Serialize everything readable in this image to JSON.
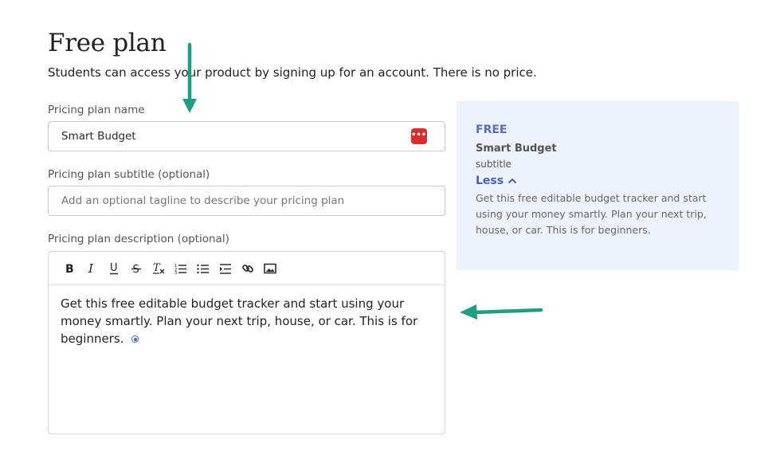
{
  "header": {
    "title": "Free plan",
    "description": "Students can access your product by signing up for an account. There is no price."
  },
  "form": {
    "name_label": "Pricing plan name",
    "name_value": "Smart Budget",
    "password_manager_glyph": "•••|",
    "subtitle_label": "Pricing plan subtitle (optional)",
    "subtitle_placeholder": "Add an optional tagline to describe your pricing plan",
    "description_label": "Pricing plan description (optional)",
    "toolbar": [
      "bold-icon",
      "italic-icon",
      "underline-icon",
      "strikethrough-icon",
      "clear-format-icon",
      "ordered-list-icon",
      "bullet-list-icon",
      "indent-icon",
      "link-icon",
      "image-icon"
    ],
    "description_value": "Get this free editable budget tracker and start using your money smartly. Plan your next trip, house, or car. This is for beginners."
  },
  "preview": {
    "badge": "FREE",
    "name": "Smart Budget",
    "subtitle": "subtitle",
    "toggle_label": "Less",
    "description": "Get this free editable budget tracker and start using your money smartly. Plan your next trip, house, or car. This is for beginners."
  },
  "colors": {
    "accent": "#4b5fb0",
    "preview_bg": "#edf3fd",
    "annotation_arrow": "#1f9e82",
    "password_icon": "#d92f2f"
  }
}
